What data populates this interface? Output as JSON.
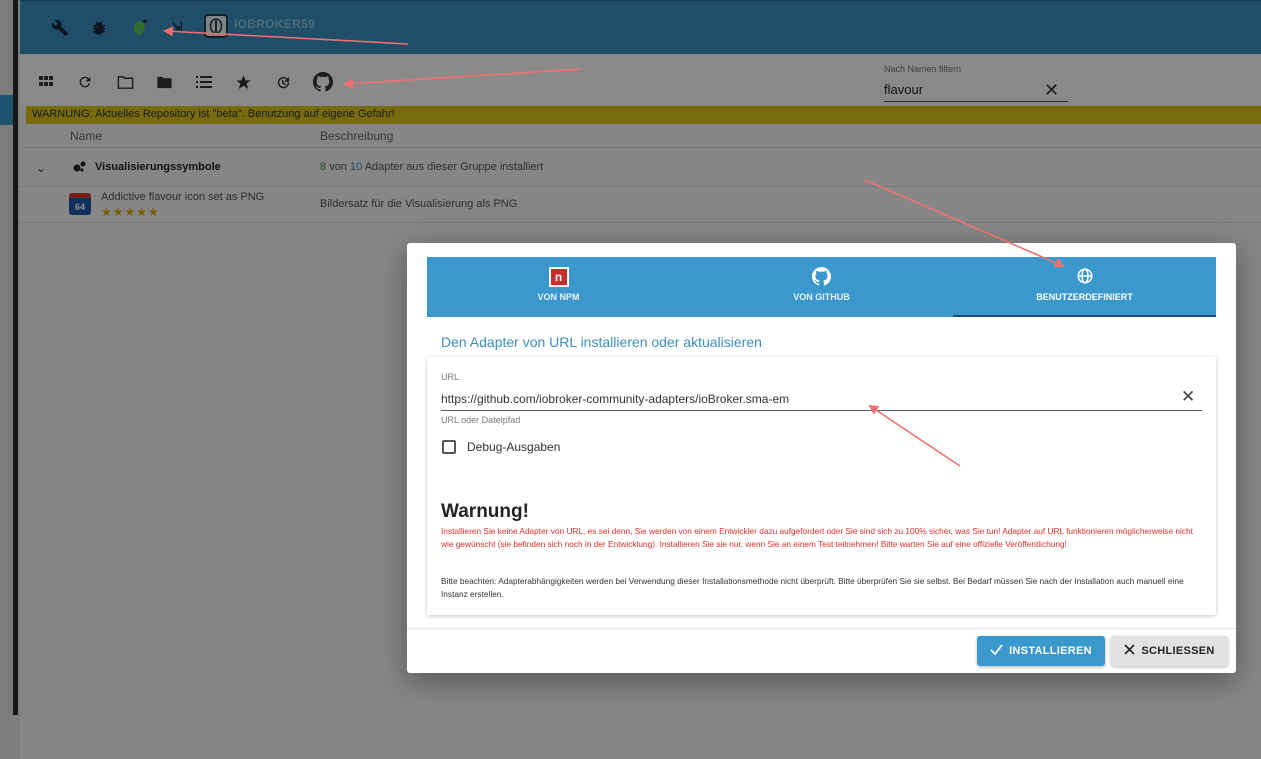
{
  "header": {
    "brand": "IOBROKER59"
  },
  "toolbar": {
    "filter_label": "Nach Namen filtern",
    "filter_value": "flavour"
  },
  "warning_bar": "WARNUNG: Aktuelles Repository ist \"beta\". Benutzung auf eigene Gefahr!",
  "table": {
    "col_name": "Name",
    "col_desc": "Beschreibung",
    "group": {
      "name": "Visualisierungssymbole",
      "installed": "8",
      "von": "von",
      "total": "10",
      "suffix": "Adapter aus dieser Gruppe installiert"
    },
    "adapter": {
      "name": "Addictive flavour icon set as PNG",
      "icon_text": "64",
      "stars": "★★★★★",
      "description": "Bildersatz für die Visualisierung als PNG"
    }
  },
  "dialog": {
    "tabs": [
      {
        "label": "VON NPM",
        "icon": "npm-icon"
      },
      {
        "label": "VON GITHUB",
        "icon": "github-icon"
      },
      {
        "label": "BENUTZERDEFINIERT",
        "icon": "globe-icon"
      }
    ],
    "title": "Den Adapter von URL installieren oder aktualisieren",
    "url_label": "URL",
    "url_value": "https://github.com/iobroker-community-adapters/ioBroker.sma-em",
    "url_helper": "URL oder Dateipfad",
    "debug_label": "Debug-Ausgaben",
    "warning_title": "Warnung!",
    "warning_text": "Installieren Sie keine Adapter von URL, es sei denn, Sie werden von einem Entwickler dazu aufgefordert oder Sie sind sich zu 100% sicher, was Sie tun! Adapter auf URL funktionieren möglicherweise nicht wie gewünscht (sie befinden sich noch in der Entwicklung). Installieren Sie sie nur, wenn Sie an einem Test teilnehmen! Bitte warten Sie auf eine offizielle Veröffentlichung!",
    "note_text": "Bitte beachten: Adapterabhängigkeiten werden bei Verwendung dieser Installationsmethode nicht überprüft. Bitte überprüfen Sie sie selbst. Bei Bedarf müssen Sie nach der Installation auch manuell eine Instanz erstellen.",
    "install_label": "INSTALLIEREN",
    "close_label": "SCHLIESSEN"
  },
  "colors": {
    "header": "#3b8fc0",
    "accent": "#3b98cc",
    "warning_bar": "#d9c31a",
    "warning_text": "#e0302a",
    "annotation_arrow": "#f07070"
  }
}
